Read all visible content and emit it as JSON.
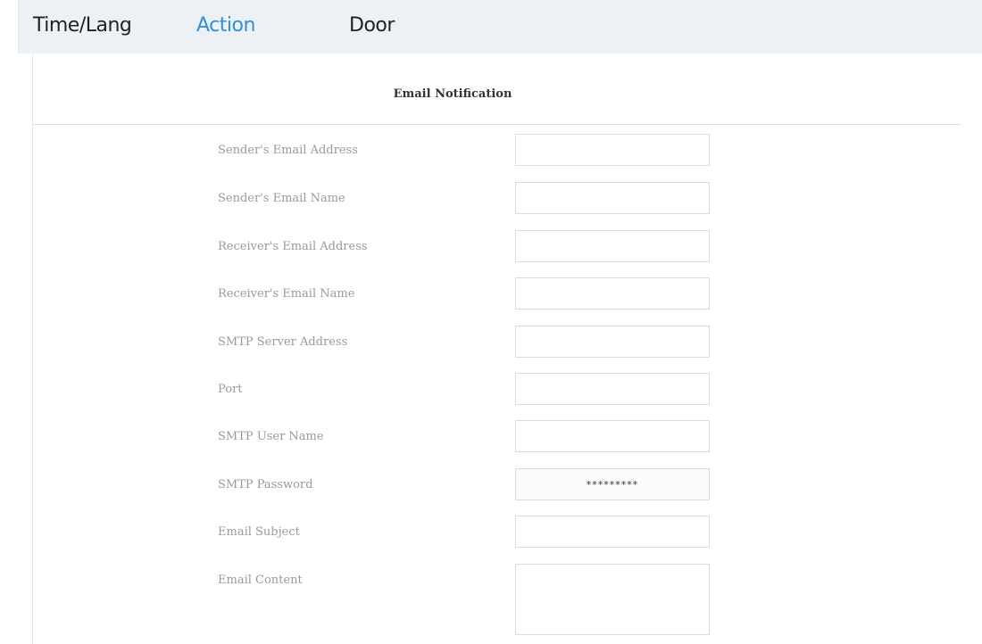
{
  "tabs": [
    {
      "label": "Time/Lang",
      "active": false
    },
    {
      "label": "Action",
      "active": true
    },
    {
      "label": "Door",
      "active": false
    }
  ],
  "section": {
    "title": "Email Notification"
  },
  "form": {
    "sender_address": {
      "label": "Sender's Email Address",
      "value": ""
    },
    "sender_name": {
      "label": "Sender's Email Name",
      "value": ""
    },
    "receiver_address": {
      "label": "Receiver's Email Address",
      "value": ""
    },
    "receiver_name": {
      "label": "Receiver's Email Name",
      "value": ""
    },
    "smtp_server": {
      "label": "SMTP Server Address",
      "value": ""
    },
    "port": {
      "label": "Port",
      "value": ""
    },
    "smtp_user": {
      "label": "SMTP User Name",
      "value": ""
    },
    "smtp_password": {
      "label": "SMTP Password",
      "value": "*********"
    },
    "subject": {
      "label": "Email Subject",
      "value": ""
    },
    "content": {
      "label": "Email Content",
      "value": ""
    }
  },
  "colors": {
    "accent": "#2f8fd8",
    "tabbar_bg": "#edf1f6",
    "label_text": "#9a9a9a",
    "input_border": "#dcdcdc"
  }
}
